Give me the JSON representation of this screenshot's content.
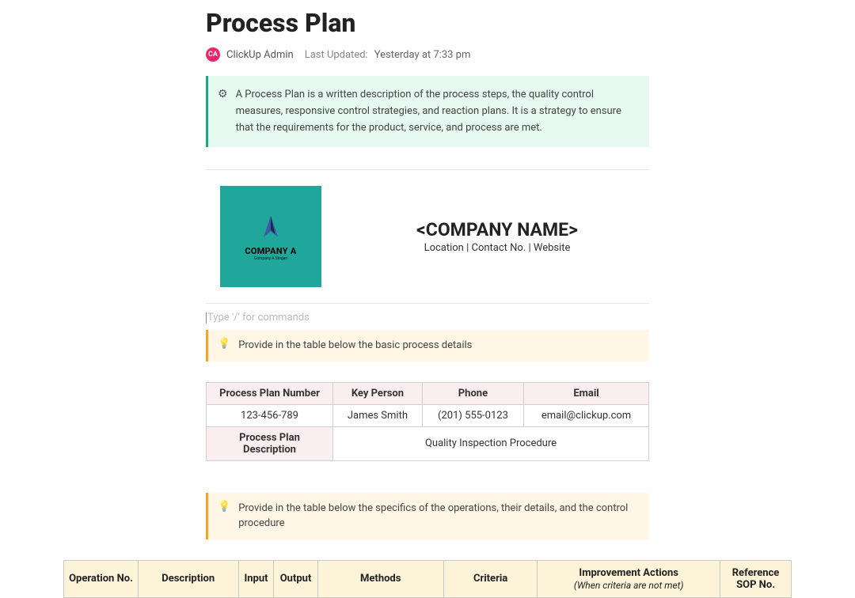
{
  "title": "Process Plan",
  "author": {
    "initials": "CA",
    "name": "ClickUp Admin"
  },
  "updated": {
    "label": "Last Updated:",
    "time": "Yesterday at 7:33 pm"
  },
  "intro": "A Process Plan is a written description of the process steps, the quality control measures, responsive control strategies, and reaction plans. It is a strategy to ensure that the requirements for the product, service, and process are met.",
  "logo": {
    "name": "COMPANY A",
    "slogan": "Company A Slogan"
  },
  "company": {
    "name": "<COMPANY NAME>",
    "sub": "Location | Contact No. | Website"
  },
  "slash_hint": "Type '/' for commands",
  "tip1": "Provide in the table below the basic process details",
  "info": {
    "headers": {
      "num": "Process Plan Number",
      "person": "Key Person",
      "phone": "Phone",
      "email": "Email"
    },
    "values": {
      "num": "123-456-789",
      "person": "James Smith",
      "phone": "(201) 555-0123",
      "email": "email@clickup.com"
    },
    "desc_label": "Process Plan Description",
    "desc_value": "Quality Inspection Procedure"
  },
  "tip2": "Provide in the table below the specifics of the operations, their details, and the control procedure",
  "ops_headers": {
    "op": "Operation No.",
    "desc": "Description",
    "input": "Input",
    "output": "Output",
    "methods": "Methods",
    "criteria": "Criteria",
    "imp": "Improvement Actions",
    "imp_note": "(When criteria are not met)",
    "ref": "Reference SOP No."
  }
}
